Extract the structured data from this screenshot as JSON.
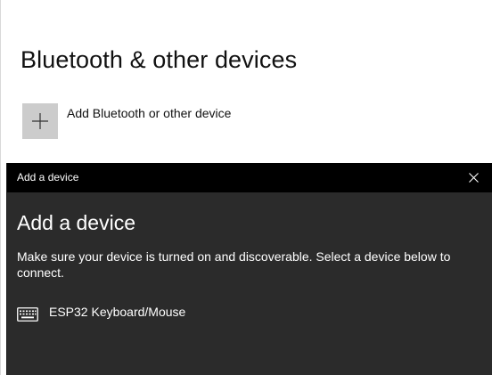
{
  "settings": {
    "title": "Bluetooth & other devices",
    "add_device_label": "Add Bluetooth or other device",
    "add_icon": "plus-icon"
  },
  "dialog": {
    "window_title": "Add a device",
    "heading": "Add a device",
    "instructions": "Make sure your device is turned on and discoverable. Select a device below to connect.",
    "close_icon": "close-icon",
    "devices": [
      {
        "name": "ESP32 Keyboard/Mouse",
        "icon": "keyboard-icon"
      }
    ]
  },
  "colors": {
    "dialog_background": "#2b2b2b",
    "titlebar_background": "#000000",
    "add_tile": "#cccccc"
  }
}
